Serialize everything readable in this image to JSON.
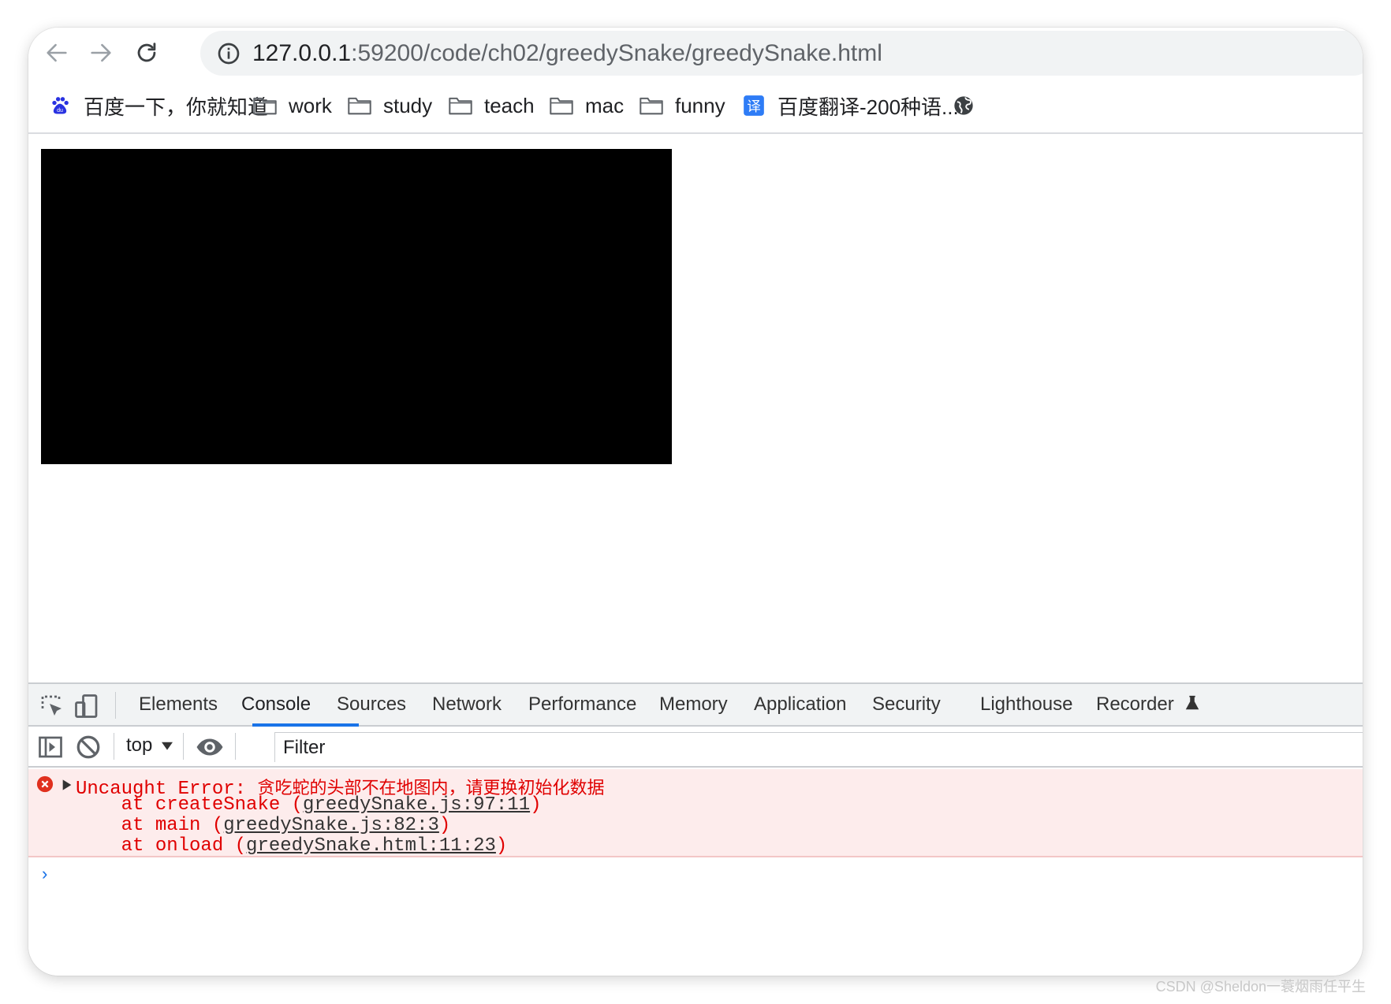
{
  "browser": {
    "url_host": "127.0.0.1",
    "url_path": ":59200/code/ch02/greedySnake/greedySnake.html"
  },
  "bookmarks": [
    {
      "label": "百度一下，你就知道",
      "icon": "baidu-icon"
    },
    {
      "label": "work",
      "icon": "folder-icon"
    },
    {
      "label": "study",
      "icon": "folder-icon"
    },
    {
      "label": "teach",
      "icon": "folder-icon"
    },
    {
      "label": "mac",
      "icon": "folder-icon"
    },
    {
      "label": "funny",
      "icon": "folder-icon"
    },
    {
      "label": "百度翻译-200种语...",
      "icon": "translate-icon"
    },
    {
      "label": "",
      "icon": "globe-icon"
    }
  ],
  "devtools": {
    "tabs": [
      "Elements",
      "Console",
      "Sources",
      "Network",
      "Performance",
      "Memory",
      "Application",
      "Security",
      "Lighthouse",
      "Recorder"
    ],
    "active_tab": "Console",
    "context": "top",
    "filter_placeholder": "Filter",
    "error": {
      "prefix": "Uncaught Error: ",
      "message": "贪吃蛇的头部不在地图内，请更换初始化数据",
      "stack": [
        {
          "pre": "    at createSnake (",
          "link": "greedySnake.js:97:11",
          "post": ")"
        },
        {
          "pre": "    at main (",
          "link": "greedySnake.js:82:3",
          "post": ")"
        },
        {
          "pre": "    at onload (",
          "link": "greedySnake.html:11:23",
          "post": ")"
        }
      ]
    },
    "prompt": "›"
  },
  "watermark": "CSDN @Sheldon一蓑烟雨任平生",
  "colors": {
    "error_text": "#e00000",
    "error_bg": "#fdecec",
    "accent": "#1a73e8"
  }
}
